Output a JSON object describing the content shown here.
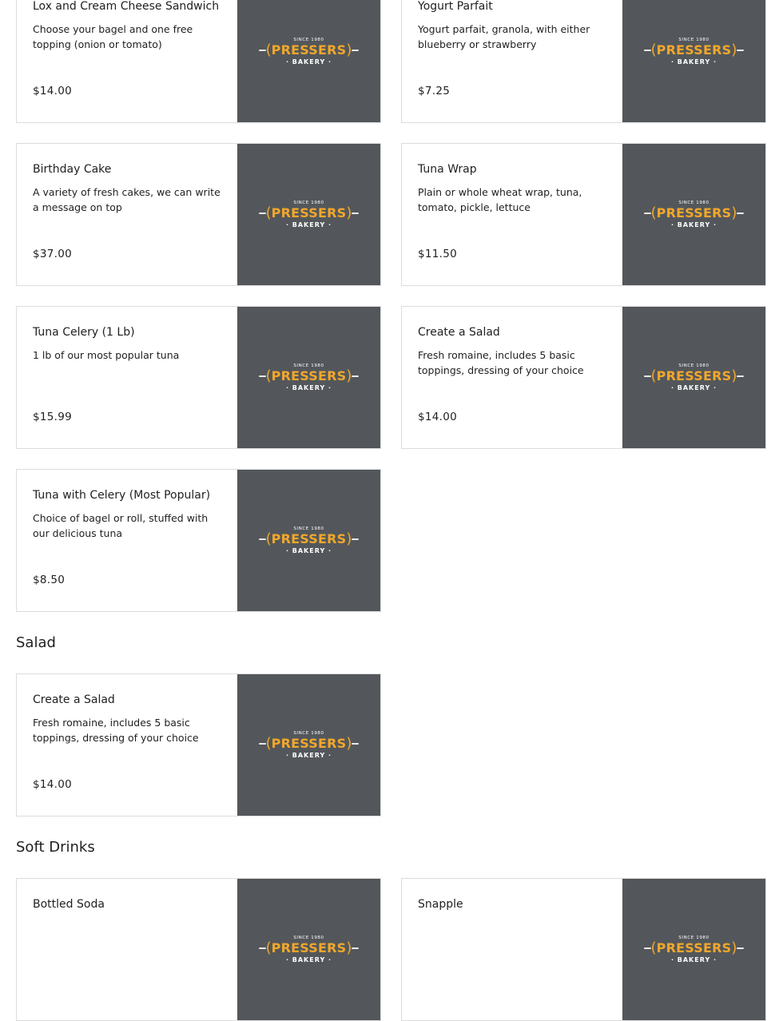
{
  "logo": {
    "since": "SINCE 1980",
    "brand": "PRESSERS",
    "sub": "· BAKERY ·"
  },
  "colors": {
    "thumb_bg": "#53575b",
    "brand_accent": "#f2a72b",
    "card_border": "#dcdcdc"
  },
  "items": [
    {
      "name": "Lox and Cream Cheese Sandwich",
      "desc": "Choose your bagel and one free topping (onion or tomato)",
      "price": "$14.00"
    },
    {
      "name": "Yogurt Parfait",
      "desc": "Yogurt parfait, granola, with either blueberry or strawberry",
      "price": "$7.25"
    },
    {
      "name": "Birthday Cake",
      "desc": "A variety of fresh cakes, we can write a message on top",
      "price": "$37.00"
    },
    {
      "name": "Tuna Wrap",
      "desc": "Plain or whole wheat wrap, tuna, tomato, pickle, lettuce",
      "price": "$11.50"
    },
    {
      "name": "Tuna Celery (1 Lb)",
      "desc": "1 lb of our most popular tuna",
      "price": "$15.99"
    },
    {
      "name": "Create a Salad",
      "desc": "Fresh romaine, includes 5 basic toppings, dressing of your choice",
      "price": "$14.00"
    },
    {
      "name": "Tuna with Celery (Most Popular)",
      "desc": "Choice of bagel or roll, stuffed with our delicious tuna",
      "price": "$8.50"
    }
  ],
  "sections": {
    "salad": {
      "title": "Salad",
      "items": [
        {
          "name": "Create a Salad",
          "desc": "Fresh romaine, includes 5 basic toppings, dressing of your choice",
          "price": "$14.00"
        }
      ]
    },
    "soft_drinks": {
      "title": "Soft Drinks",
      "items": [
        {
          "name": "Bottled Soda"
        },
        {
          "name": "Snapple"
        }
      ]
    }
  }
}
